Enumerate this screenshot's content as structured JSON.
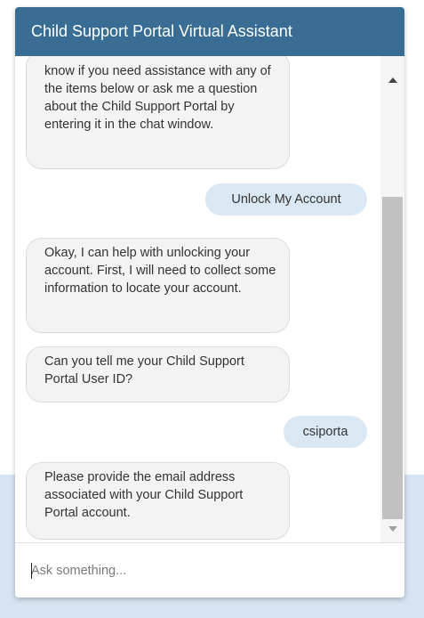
{
  "header": {
    "title": "Child Support Portal Virtual Assistant"
  },
  "messages": [
    {
      "from": "bot",
      "text": "know if you need assistance with any of the items below or ask me a question about the Child Support Portal by entering it in the chat window."
    },
    {
      "from": "user",
      "text": "Unlock My Account"
    },
    {
      "from": "bot",
      "text": "Okay, I can help with unlocking your account. First, I will need to collect some information to locate your account."
    },
    {
      "from": "bot",
      "text": "Can you tell me your Child Support Portal User ID?"
    },
    {
      "from": "user",
      "text": "csiporta"
    },
    {
      "from": "bot",
      "text": "Please provide the email address associated with your Child Support Portal account."
    }
  ],
  "input": {
    "placeholder": "Ask something..."
  },
  "colors": {
    "header": "#3a6d93",
    "user_bubble": "#d9e8f3",
    "bot_bubble": "#f3f3f3"
  },
  "scrollbar": {
    "up_icon": "triangle-up",
    "down_icon": "triangle-down"
  }
}
